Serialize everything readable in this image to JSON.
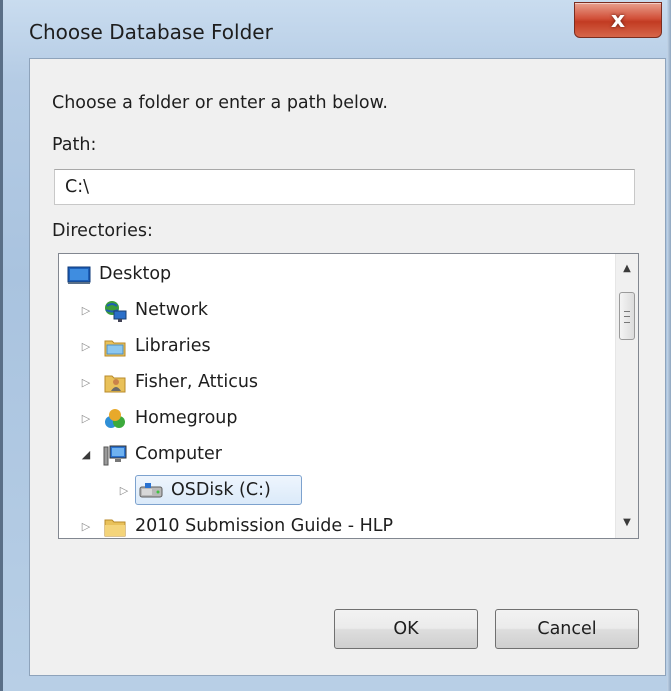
{
  "window": {
    "title": "Choose Database Folder",
    "close_glyph": "x"
  },
  "form": {
    "instruction": "Choose a folder or enter a path below.",
    "path_label": "Path:",
    "path_value": "C:\\",
    "directories_label": "Directories:"
  },
  "tree": {
    "items": [
      {
        "label": "Desktop",
        "icon": "desktop-icon",
        "expander": "none"
      },
      {
        "label": "Network",
        "icon": "network-icon",
        "expander": "collapsed"
      },
      {
        "label": "Libraries",
        "icon": "libraries-icon",
        "expander": "collapsed"
      },
      {
        "label": "Fisher, Atticus",
        "icon": "user-folder-icon",
        "expander": "collapsed"
      },
      {
        "label": "Homegroup",
        "icon": "homegroup-icon",
        "expander": "collapsed"
      },
      {
        "label": "Computer",
        "icon": "computer-icon",
        "expander": "expanded"
      },
      {
        "label": "OSDisk (C:)",
        "icon": "drive-icon",
        "expander": "collapsed",
        "selected": true
      },
      {
        "label": "2010 Submission Guide - HLP",
        "icon": "folder-icon",
        "expander": "collapsed"
      }
    ]
  },
  "buttons": {
    "ok": "OK",
    "cancel": "Cancel"
  },
  "colors": {
    "selection_border": "#7da2ce",
    "close_button": "#c23b22"
  }
}
